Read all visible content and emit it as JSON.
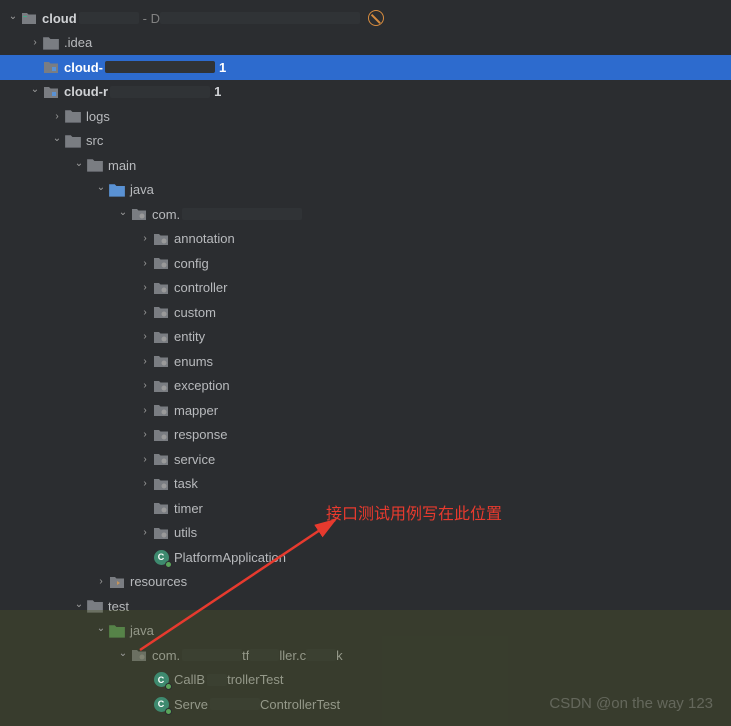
{
  "annotation": "接口测试用例写在此位置",
  "watermark": "CSDN @on the way 123",
  "tree": [
    {
      "depth": 0,
      "chev": "down",
      "icon": "project",
      "label": "cloud",
      "bold": true,
      "redactedAfter": 60,
      "path": " - D",
      "redacted2": 200,
      "cancel": true
    },
    {
      "depth": 1,
      "chev": "right",
      "icon": "folder-gray",
      "label": ".idea"
    },
    {
      "depth": 1,
      "chev": "",
      "icon": "module",
      "label": "cloud-",
      "bold": true,
      "redactedAfter": 110,
      "selected": true,
      "trailNum": "1"
    },
    {
      "depth": 1,
      "chev": "down",
      "icon": "module",
      "label": "cloud-r",
      "bold": true,
      "redactedAfter": 100,
      "trailNum": "1"
    },
    {
      "depth": 2,
      "chev": "right",
      "icon": "folder-gray",
      "label": "logs"
    },
    {
      "depth": 2,
      "chev": "down",
      "icon": "folder-gray",
      "label": "src"
    },
    {
      "depth": 3,
      "chev": "down",
      "icon": "folder-gray",
      "label": "main"
    },
    {
      "depth": 4,
      "chev": "down",
      "icon": "folder-src",
      "label": "java"
    },
    {
      "depth": 5,
      "chev": "down",
      "icon": "package",
      "label": "com.",
      "redactedAfter": 120
    },
    {
      "depth": 6,
      "chev": "right",
      "icon": "package",
      "label": "annotation"
    },
    {
      "depth": 6,
      "chev": "right",
      "icon": "package",
      "label": "config"
    },
    {
      "depth": 6,
      "chev": "right",
      "icon": "package",
      "label": "controller"
    },
    {
      "depth": 6,
      "chev": "right",
      "icon": "package",
      "label": "custom"
    },
    {
      "depth": 6,
      "chev": "right",
      "icon": "package",
      "label": "entity"
    },
    {
      "depth": 6,
      "chev": "right",
      "icon": "package",
      "label": "enums"
    },
    {
      "depth": 6,
      "chev": "right",
      "icon": "package",
      "label": "exception"
    },
    {
      "depth": 6,
      "chev": "right",
      "icon": "package",
      "label": "mapper"
    },
    {
      "depth": 6,
      "chev": "right",
      "icon": "package",
      "label": "response"
    },
    {
      "depth": 6,
      "chev": "right",
      "icon": "package",
      "label": "service"
    },
    {
      "depth": 6,
      "chev": "right",
      "icon": "package",
      "label": "task"
    },
    {
      "depth": 6,
      "chev": "",
      "icon": "package",
      "label": "timer"
    },
    {
      "depth": 6,
      "chev": "right",
      "icon": "package",
      "label": "utils"
    },
    {
      "depth": 6,
      "chev": "",
      "icon": "class-run",
      "label": "PlatformApplication"
    },
    {
      "depth": 4,
      "chev": "right",
      "icon": "folder-res",
      "label": "resources"
    },
    {
      "depth": 3,
      "chev": "down",
      "icon": "folder-gray",
      "label": "test"
    },
    {
      "depth": 4,
      "chev": "down",
      "icon": "folder-test",
      "label": "java"
    },
    {
      "depth": 5,
      "chev": "down",
      "icon": "package",
      "label": "com.",
      "redactedAfter": 60,
      "midText": "tf",
      "redacted2": 30,
      "midText2": "ller.c",
      "redacted3": 30,
      "trailText": "k"
    },
    {
      "depth": 6,
      "chev": "",
      "icon": "class-run",
      "label": "CallB",
      "redactedAfter": 20,
      "trailText": "trollerTest"
    },
    {
      "depth": 6,
      "chev": "",
      "icon": "class-run",
      "label": "Serve",
      "redactedAfter": 50,
      "trailText": "ControllerTest"
    }
  ]
}
